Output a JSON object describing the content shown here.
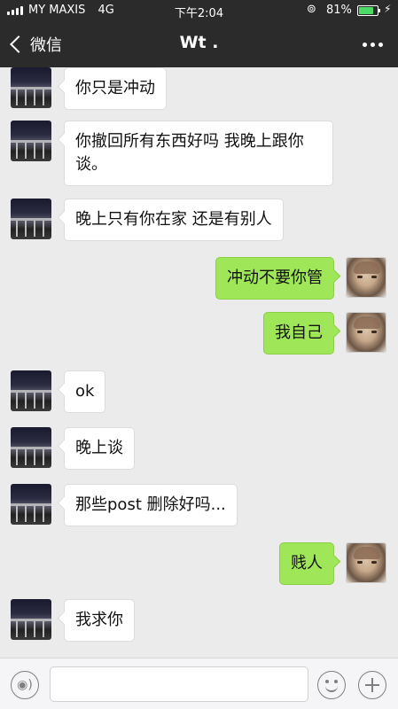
{
  "status_bar": {
    "carrier": "MY MAXIS",
    "network": "4G",
    "time": "下午2:04",
    "battery_percent": "81%",
    "battery_level": 0.81
  },
  "nav": {
    "back_label": "微信",
    "title": "Wt ."
  },
  "messages": [
    {
      "from": "them",
      "text": "你只是冲动"
    },
    {
      "from": "them",
      "text": "你撤回所有东西好吗 我晚上跟你谈。"
    },
    {
      "from": "them",
      "text": "晚上只有你在家 还是有别人"
    },
    {
      "from": "me",
      "text": "冲动不要你管"
    },
    {
      "from": "me",
      "text": "我自己"
    },
    {
      "from": "them",
      "text": "ok"
    },
    {
      "from": "them",
      "text": "晚上谈"
    },
    {
      "from": "them",
      "text": "那些post 删除好吗..."
    },
    {
      "from": "me",
      "text": "贱人"
    },
    {
      "from": "them",
      "text": "我求你"
    }
  ],
  "input_bar": {
    "placeholder": "",
    "icons": [
      "voice-icon",
      "emoji-icon",
      "plus-icon"
    ]
  }
}
